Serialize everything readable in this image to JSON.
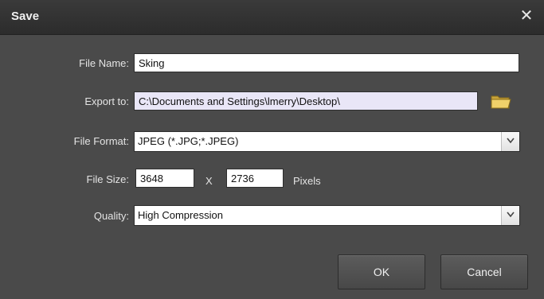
{
  "window": {
    "title": "Save",
    "close_glyph": "✕"
  },
  "form": {
    "file_name": {
      "label": "File Name:",
      "value": "Sking"
    },
    "export_to": {
      "label": "Export to:",
      "value": "C:\\Documents and Settings\\lmerry\\Desktop\\",
      "browse_icon": "folder-icon"
    },
    "file_format": {
      "label": "File Format:",
      "value": "JPEG (*.JPG;*.JPEG)"
    },
    "file_size": {
      "label": "File Size:",
      "width": "3648",
      "separator": "X",
      "height": "2736",
      "units": "Pixels"
    },
    "quality": {
      "label": "Quality:",
      "value": "High Compression"
    }
  },
  "buttons": {
    "ok": "OK",
    "cancel": "Cancel"
  },
  "colors": {
    "background": "#4a4a4a",
    "titlebar": "#2c2c2c",
    "field": "#ffffff",
    "readonly_field": "#e9e6f7",
    "folder": "#e8c85a"
  }
}
